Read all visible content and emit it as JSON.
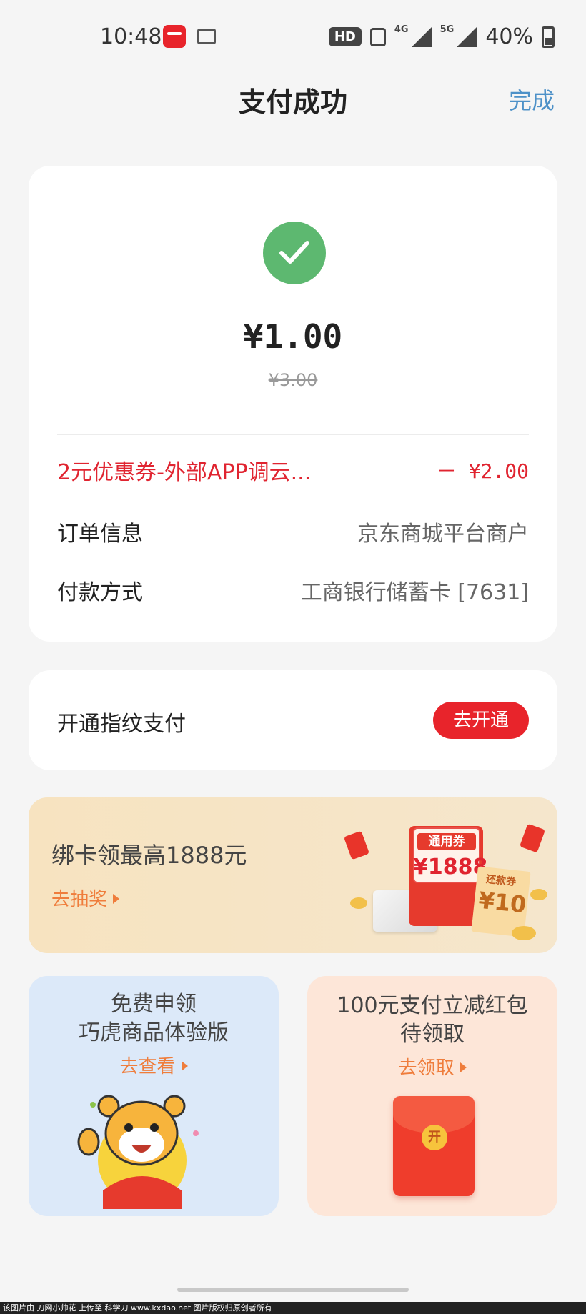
{
  "status_bar": {
    "time": "10:48",
    "hd_badge": "HD",
    "network_4g": "4G",
    "network_5g": "5G",
    "battery": "40%",
    "icons": [
      "payment-app-icon",
      "gallery-icon",
      "vibrate-icon",
      "signal-icon",
      "battery-icon"
    ]
  },
  "header": {
    "title": "支付成功",
    "done_label": "完成"
  },
  "payment": {
    "amount": "¥1.00",
    "original_amount": "¥3.00",
    "discount_label": "2元优惠券-外部APP调云...",
    "discount_value": "－ ¥2.00",
    "order_label": "订单信息",
    "order_value": "京东商城平台商户",
    "method_label": "付款方式",
    "method_value": "工商银行储蓄卡 [7631]"
  },
  "fingerprint": {
    "label": "开通指纹支付",
    "button_label": "去开通"
  },
  "banner": {
    "title": "绑卡领最高1888元",
    "link": "去抽奖",
    "coupon_label": "通用券",
    "coupon_value": "¥1888",
    "ticket_label": "还款券",
    "ticket_value": "¥10"
  },
  "tiles": [
    {
      "line1": "免费申领",
      "line2": "巧虎商品体验版",
      "link": "去查看"
    },
    {
      "line1": "100元支付立减红包",
      "line2": "待领取",
      "link": "去领取",
      "envelope_text": "开"
    }
  ],
  "footer": {
    "note": "该图片由 刀网小帅花 上传至 科学刀 www.kxdao.net 图片版权归原创者所有"
  },
  "colors": {
    "accent_red": "#e8242b",
    "success_green": "#5db870",
    "link_blue": "#4d91c8",
    "link_orange": "#ef7d3c"
  }
}
